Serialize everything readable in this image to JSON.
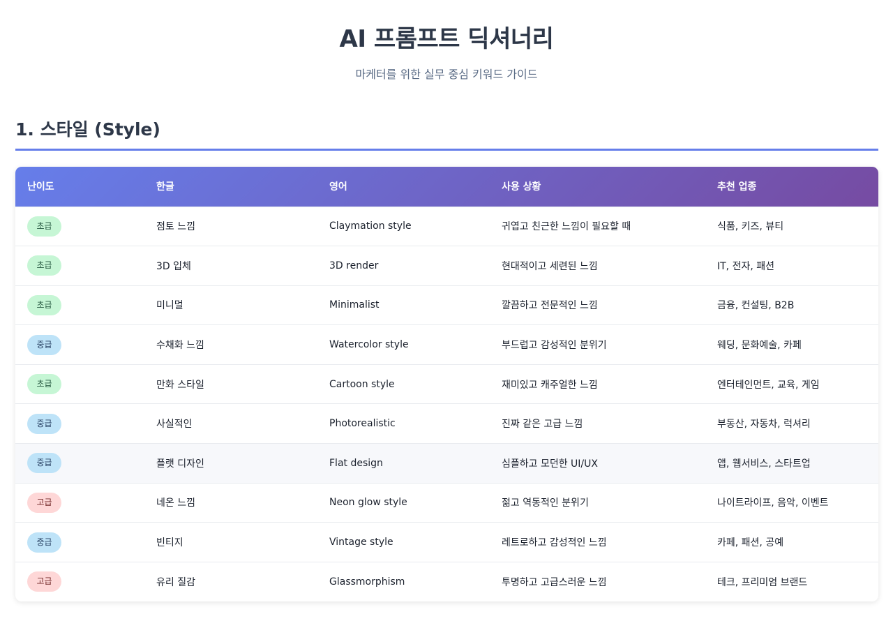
{
  "header": {
    "title": "AI 프롬프트 딕셔너리",
    "subtitle": "마케터를 위한 실무 중심 키워드 가이드"
  },
  "section": {
    "title": "1. 스타일 (Style)"
  },
  "table": {
    "columns": [
      "난이도",
      "한글",
      "영어",
      "사용 상황",
      "추천 업종"
    ],
    "rows": [
      {
        "level": "초급",
        "level_type": "beginner",
        "korean": "점토 느낌",
        "english": "Claymation style",
        "usage": "귀엽고 친근한 느낌이 필요할 때",
        "industry": "식품, 키즈, 뷰티"
      },
      {
        "level": "초급",
        "level_type": "beginner",
        "korean": "3D 입체",
        "english": "3D render",
        "usage": "현대적이고 세련된 느낌",
        "industry": "IT, 전자, 패션"
      },
      {
        "level": "초급",
        "level_type": "beginner",
        "korean": "미니멀",
        "english": "Minimalist",
        "usage": "깔끔하고 전문적인 느낌",
        "industry": "금융, 컨설팅, B2B"
      },
      {
        "level": "중급",
        "level_type": "intermediate",
        "korean": "수채화 느낌",
        "english": "Watercolor style",
        "usage": "부드럽고 감성적인 분위기",
        "industry": "웨딩, 문화예술, 카페"
      },
      {
        "level": "초급",
        "level_type": "beginner",
        "korean": "만화 스타일",
        "english": "Cartoon style",
        "usage": "재미있고 캐주얼한 느낌",
        "industry": "엔터테인먼트, 교육, 게임"
      },
      {
        "level": "중급",
        "level_type": "intermediate",
        "korean": "사실적인",
        "english": "Photorealistic",
        "usage": "진짜 같은 고급 느낌",
        "industry": "부동산, 자동차, 럭셔리"
      },
      {
        "level": "중급",
        "level_type": "intermediate",
        "korean": "플랫 디자인",
        "english": "Flat design",
        "usage": "심플하고 모던한 UI/UX",
        "industry": "앱, 웹서비스, 스타트업"
      },
      {
        "level": "고급",
        "level_type": "advanced",
        "korean": "네온 느낌",
        "english": "Neon glow style",
        "usage": "젊고 역동적인 분위기",
        "industry": "나이트라이프, 음악, 이벤트"
      },
      {
        "level": "중급",
        "level_type": "intermediate",
        "korean": "빈티지",
        "english": "Vintage style",
        "usage": "레트로하고 감성적인 느낌",
        "industry": "카페, 패션, 공예"
      },
      {
        "level": "고급",
        "level_type": "advanced",
        "korean": "유리 질감",
        "english": "Glassmorphism",
        "usage": "투명하고 고급스러운 느낌",
        "industry": "테크, 프리미엄 브랜드"
      }
    ]
  },
  "colors": {
    "accent": "#667eea",
    "header_gradient_start": "#667eea",
    "header_gradient_end": "#764ba2",
    "beginner_badge": "#c6f6d5",
    "intermediate_badge": "#bee3f8",
    "advanced_badge": "#fed7d7"
  }
}
